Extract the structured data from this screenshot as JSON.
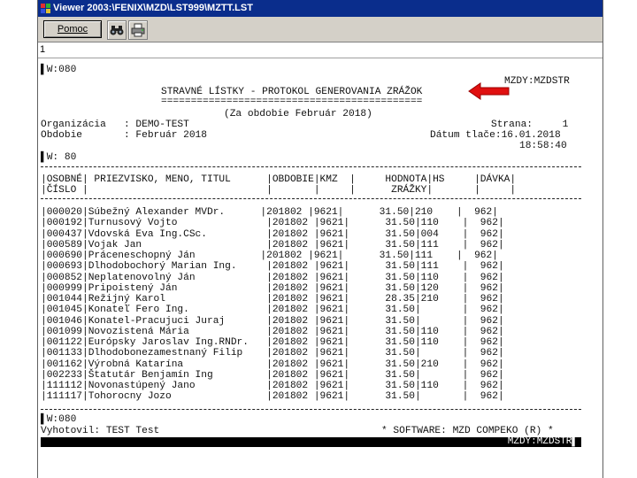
{
  "window": {
    "title": "Viewer 2003:\\FENIX\\MZD\\LST999\\MZTT.LST"
  },
  "toolbar": {
    "help_label": "Pomoc",
    "find_icon": "binoculars-icon",
    "print_icon": "print-icon"
  },
  "page_indicator": "1",
  "report": {
    "w_top": "▌W:080",
    "code_right": "MZDY:MZDSTR",
    "title": "STRAVNÉ LÍSTKY - PROTOKOL GENEROVANIA ZRÁŽOK",
    "title_underline": "============================================",
    "period_line": "(Za obdobie Február 2018)",
    "org_line": "Organizácia   : DEMO-TEST",
    "page_line": "Strana:     1",
    "obdobie_line": "Obdobie       : Február 2018",
    "print_date_line": "Dátum tlače:16.01.2018",
    "print_time_line": "18:58:40",
    "w_mid": "▌W: 80",
    "header1": "|OSOBNÉ| PRIEZVISKO, MENO, TITUL      |OBDOBIE|KMZ  |     HODNOTA|HS     |DÁVKA|",
    "header2": "|ČÍSLO |                              |       |     |      ZRÁŽKY|       |     |",
    "rows": [
      "|000020|Súbežný Alexander MVDr.      |201802 |9621|      31.50|210    |  962|",
      "|000192|Turnusový Vojto               |201802 |9621|      31.50|110    |  962|",
      "|000437|Vdovská Eva Ing.CSc.          |201802 |9621|      31.50|004    |  962|",
      "|000589|Vojak Jan                     |201802 |9621|      31.50|111    |  962|",
      "|000690|Práceneschopný Ján           |201802 |9621|      31.50|111    |  962|",
      "|000693|Dlhodobochorý Marian Ing.     |201802 |9621|      31.50|111    |  962|",
      "|000852|Neplatenovolný Ján            |201802 |9621|      31.50|110    |  962|",
      "|000999|Pripoistený Ján               |201802 |9621|      31.50|120    |  962|",
      "|001044|Režijný Karol                 |201802 |9621|      28.35|210    |  962|",
      "|001045|Konateľ Fero Ing.             |201802 |9621|      31.50|       |  962|",
      "|001046|Konatel-Pracujuci Juraj       |201802 |9621|      31.50|       |  962|",
      "|001099|Novozistená Mária             |201802 |9621|      31.50|110    |  962|",
      "|001122|Európsky Jaroslav Ing.RNDr.   |201802 |9621|      31.50|110    |  962|",
      "|001133|Dlhodobonezamestnaný Filip    |201802 |9621|      31.50|       |  962|",
      "|001162|Výrobná Katarína              |201802 |9621|      31.50|210    |  962|",
      "|002233|Štatutár Benjamín Ing         |201802 |9621|      31.50|       |  962|",
      "|111112|Novonastúpený Jano            |201802 |9621|      31.50|110    |  962|",
      "|111117|Tohorocny Jozo                |201802 |9621|      31.50|       |  962|"
    ],
    "w_bottom": "▌W:080",
    "vyhotovil_line": "Vyhotovil: TEST Test",
    "software_line": "* SOFTWARE: MZD COMPEKO (R) *",
    "footer_code": "MZDY:MZDSTR▌"
  },
  "annotation": {
    "arrow_color": "#e01010",
    "arrow_icon": "arrow-left-icon"
  }
}
